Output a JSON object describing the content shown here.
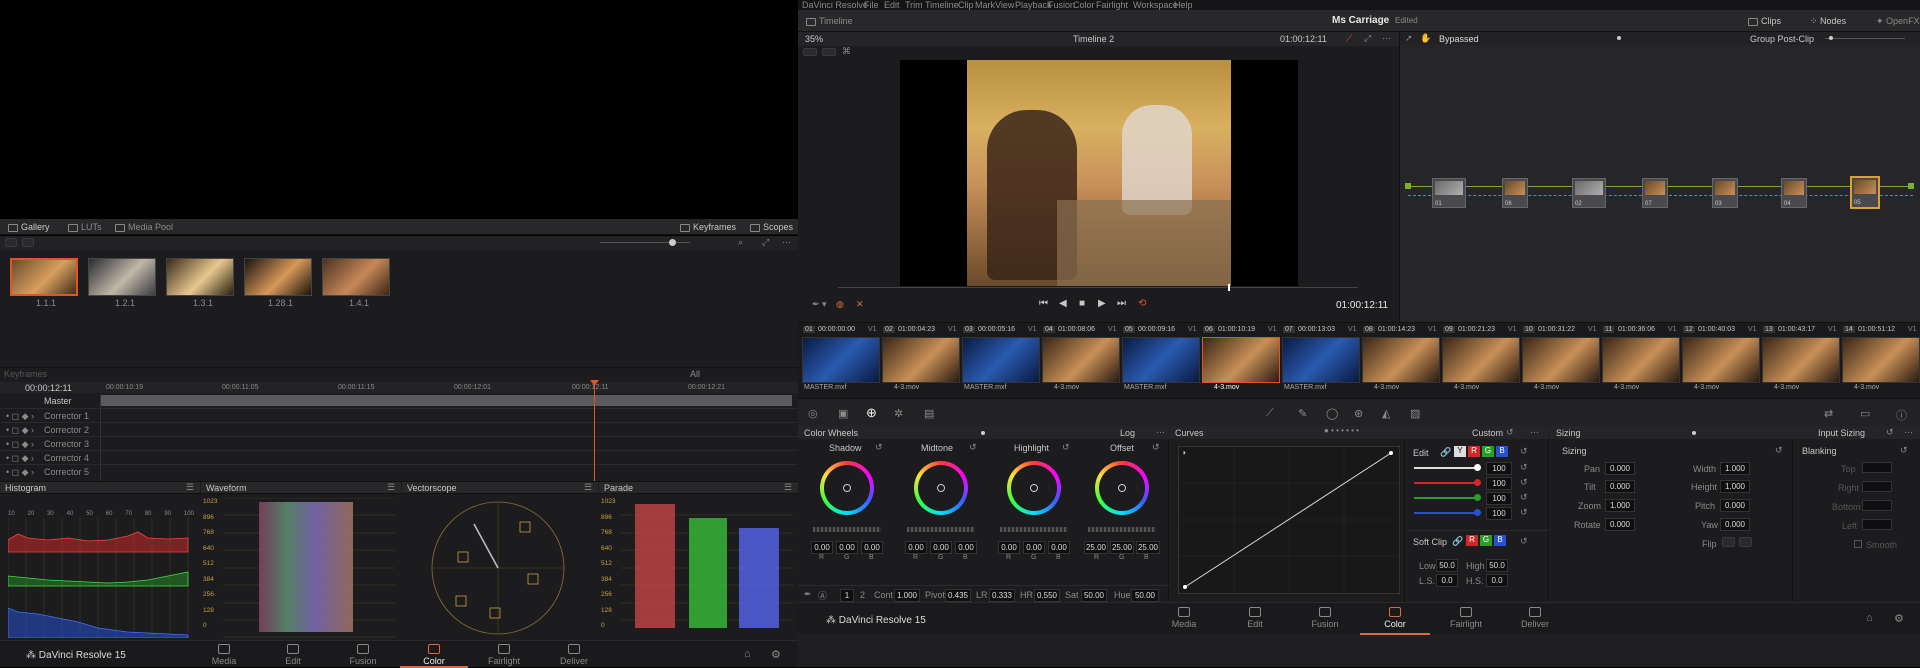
{
  "menu": [
    "DaVinci Resolve",
    "File",
    "Edit",
    "Trim",
    "Timeline",
    "Clip",
    "Mark",
    "View",
    "Playback",
    "Fusion",
    "Color",
    "Fairlight",
    "Workspace",
    "Help"
  ],
  "header": {
    "timeline_label": "Timeline",
    "project": "Ms Carriage",
    "edited": "Edited",
    "clips": "Clips",
    "nodes": "Nodes",
    "openfx": "OpenFX"
  },
  "viewer": {
    "zoom": "35%",
    "timeline_name": "Timeline 2",
    "tc_top": "01:00:12:11",
    "timecode": "01:00:12:11"
  },
  "node_editor": {
    "bypassed": "Bypassed",
    "group": "Group Post-Clip",
    "nodes": [
      "01",
      "06",
      "02",
      "07",
      "03",
      "04",
      "05"
    ]
  },
  "gallery": {
    "tabs": [
      "Gallery",
      "LUTs",
      "Media Pool"
    ],
    "keyframes": "Keyframes",
    "scopes": "Scopes",
    "stills": [
      "1.1.1",
      "1.2.1",
      "1.3.1",
      "1.28.1",
      "1.4.1"
    ]
  },
  "keyframes": {
    "title": "Keyframes",
    "filter": "All",
    "timecode": "00:00:12:11",
    "ruler": [
      "00:00:10:19",
      "00:00:11:05",
      "00:00:11:15",
      "00:00:12:01",
      "00:00:12:11",
      "00:00:12:21"
    ],
    "tracks": [
      "Master",
      "Corrector 1",
      "Corrector 2",
      "Corrector 3",
      "Corrector 4",
      "Corrector 5"
    ]
  },
  "scopes": {
    "histogram": "Histogram",
    "waveform": "Waveform",
    "vectorscope": "Vectorscope",
    "parade": "Parade",
    "hist_axis": [
      "10",
      "20",
      "30",
      "40",
      "50",
      "60",
      "70",
      "80",
      "90",
      "100"
    ],
    "wave_axis": [
      "1023",
      "896",
      "768",
      "640",
      "512",
      "384",
      "256",
      "128",
      "0"
    ]
  },
  "clips": [
    {
      "num": "01",
      "tc": "00:00:00:00",
      "track": "V1",
      "name": "MASTER.mxf"
    },
    {
      "num": "02",
      "tc": "01:00:04:23",
      "track": "V1",
      "name": "4-3.mov"
    },
    {
      "num": "03",
      "tc": "00:00:05:16",
      "track": "V1",
      "name": "MASTER.mxf"
    },
    {
      "num": "04",
      "tc": "01:00:08:06",
      "track": "V1",
      "name": "4-3.mov"
    },
    {
      "num": "05",
      "tc": "00:00:09:16",
      "track": "V1",
      "name": "MASTER.mxf"
    },
    {
      "num": "06",
      "tc": "01:00:10:19",
      "track": "V1",
      "name": "4-3.mov"
    },
    {
      "num": "07",
      "tc": "00:00:13:03",
      "track": "V1",
      "name": "MASTER.mxf"
    },
    {
      "num": "08",
      "tc": "01:00:14:23",
      "track": "V1",
      "name": "4-3.mov"
    },
    {
      "num": "09",
      "tc": "01:00:21:23",
      "track": "V1",
      "name": "4-3.mov"
    },
    {
      "num": "10",
      "tc": "01:00:31:22",
      "track": "V1",
      "name": "4-3.mov"
    },
    {
      "num": "11",
      "tc": "01:00:36:06",
      "track": "V1",
      "name": "4-3.mov"
    },
    {
      "num": "12",
      "tc": "01:00:40:03",
      "track": "V1",
      "name": "4-3.mov"
    },
    {
      "num": "13",
      "tc": "01:00:43:17",
      "track": "V1",
      "name": "4-3.mov"
    },
    {
      "num": "14",
      "tc": "01:00:51:12",
      "track": "V1",
      "name": "4-3.mov"
    }
  ],
  "color_wheels": {
    "title": "Color Wheels",
    "mode": "Log",
    "wheels": [
      {
        "name": "Shadow",
        "r": "0.00",
        "g": "0.00",
        "b": "0.00"
      },
      {
        "name": "Midtone",
        "r": "0.00",
        "g": "0.00",
        "b": "0.00"
      },
      {
        "name": "Highlight",
        "r": "0.00",
        "g": "0.00",
        "b": "0.00"
      },
      {
        "name": "Offset",
        "r": "25.00",
        "g": "25.00",
        "b": "25.00"
      }
    ],
    "rgb": [
      "R",
      "G",
      "B"
    ],
    "page1": "1",
    "page2": "2",
    "cont_label": "Cont",
    "cont": "1.000",
    "pivot_label": "Pivot",
    "pivot": "0.435",
    "lr_label": "LR",
    "lr": "0.333",
    "hr_label": "HR",
    "hr": "0.550",
    "sat_label": "Sat",
    "sat": "50.00",
    "hue_label": "Hue",
    "hue": "50.00"
  },
  "curves": {
    "title": "Curves",
    "mode": "Custom",
    "edit": "Edit",
    "y": "Y",
    "r": "R",
    "g": "G",
    "b": "B",
    "values": [
      "100",
      "100",
      "100",
      "100"
    ],
    "soft_clip": "Soft Clip",
    "low_label": "Low",
    "low": "50.0",
    "high_label": "High",
    "high": "50.0",
    "ls_label": "L.S.",
    "ls": "0.0",
    "hs_label": "H.S.",
    "hs": "0.0"
  },
  "sizing": {
    "title": "Sizing",
    "mode": "Input Sizing",
    "section": "Sizing",
    "pan_label": "Pan",
    "pan": "0.000",
    "tilt_label": "Tilt",
    "tilt": "0.000",
    "zoom_label": "Zoom",
    "zoom": "1.000",
    "rotate_label": "Rotate",
    "rotate": "0.000",
    "width_label": "Width",
    "width": "1.000",
    "height_label": "Height",
    "height": "1.000",
    "pitch_label": "Pitch",
    "pitch": "0.000",
    "yaw_label": "Yaw",
    "yaw": "0.000",
    "flip_label": "Flip",
    "blanking": "Blanking",
    "b_top": "Top",
    "b_right": "Right",
    "b_bottom": "Bottom",
    "b_left": "Left",
    "smooth": "Smooth"
  },
  "nav": {
    "app": "DaVinci Resolve 15",
    "pages": [
      "Media",
      "Edit",
      "Fusion",
      "Color",
      "Fairlight",
      "Deliver"
    ],
    "active": "Color"
  },
  "colors": {
    "accent": "#e06a3c",
    "clip_highlight": "#e0542c"
  }
}
